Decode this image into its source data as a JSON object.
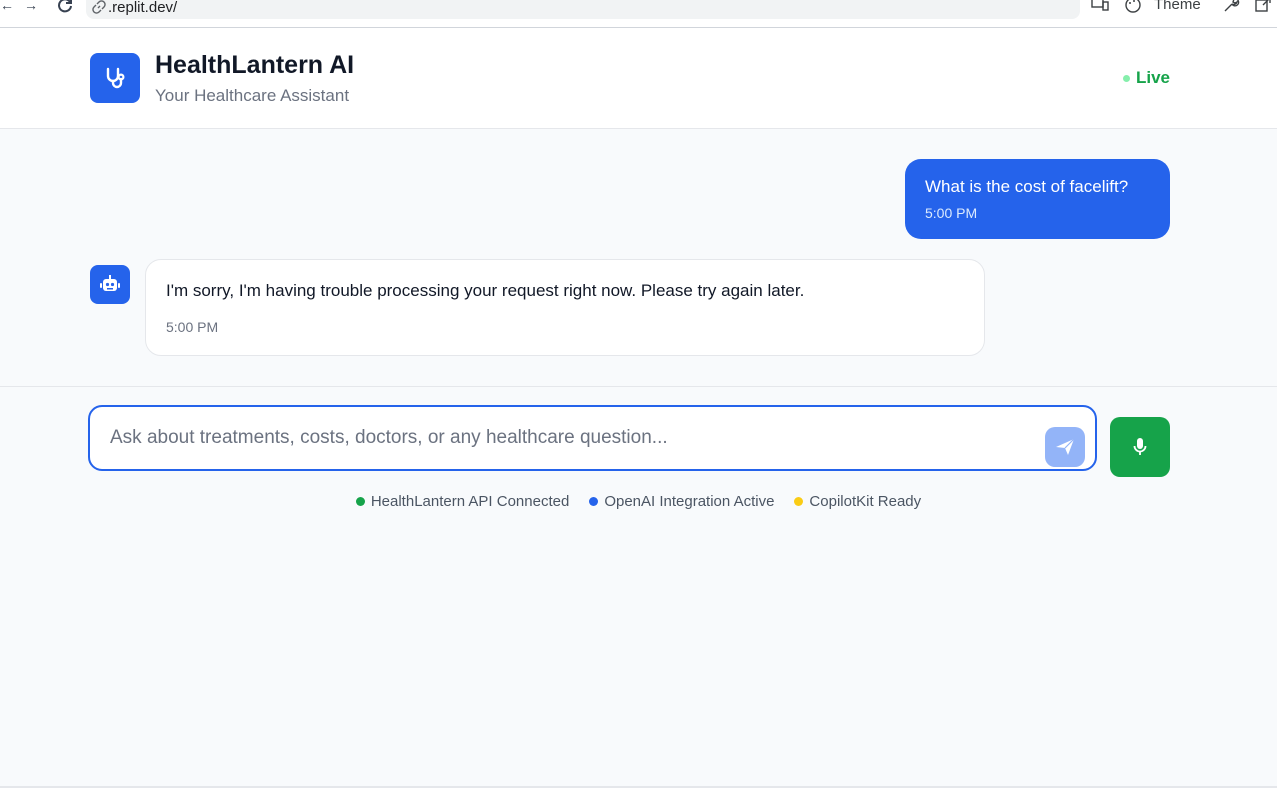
{
  "browser": {
    "url": ".replit.dev/",
    "theme_label": "Theme"
  },
  "header": {
    "title": "HealthLantern AI",
    "subtitle": "Your Healthcare Assistant",
    "status": "Live"
  },
  "messages": [
    {
      "role": "user",
      "text": "What is the cost of facelift?",
      "time": "5:00 PM"
    },
    {
      "role": "assistant",
      "text": "I'm sorry, I'm having trouble processing your request right now. Please try again later.",
      "time": "5:00 PM"
    }
  ],
  "composer": {
    "placeholder": "Ask about treatments, costs, doctors, or any healthcare question..."
  },
  "statuses": [
    {
      "label": "HealthLantern API Connected",
      "color": "#16a34a"
    },
    {
      "label": "OpenAI Integration Active",
      "color": "#2563eb"
    },
    {
      "label": "CopilotKit Ready",
      "color": "#facc15"
    }
  ],
  "colors": {
    "accent": "#2563eb",
    "mic": "#16a34a",
    "live": "#16a34a"
  }
}
